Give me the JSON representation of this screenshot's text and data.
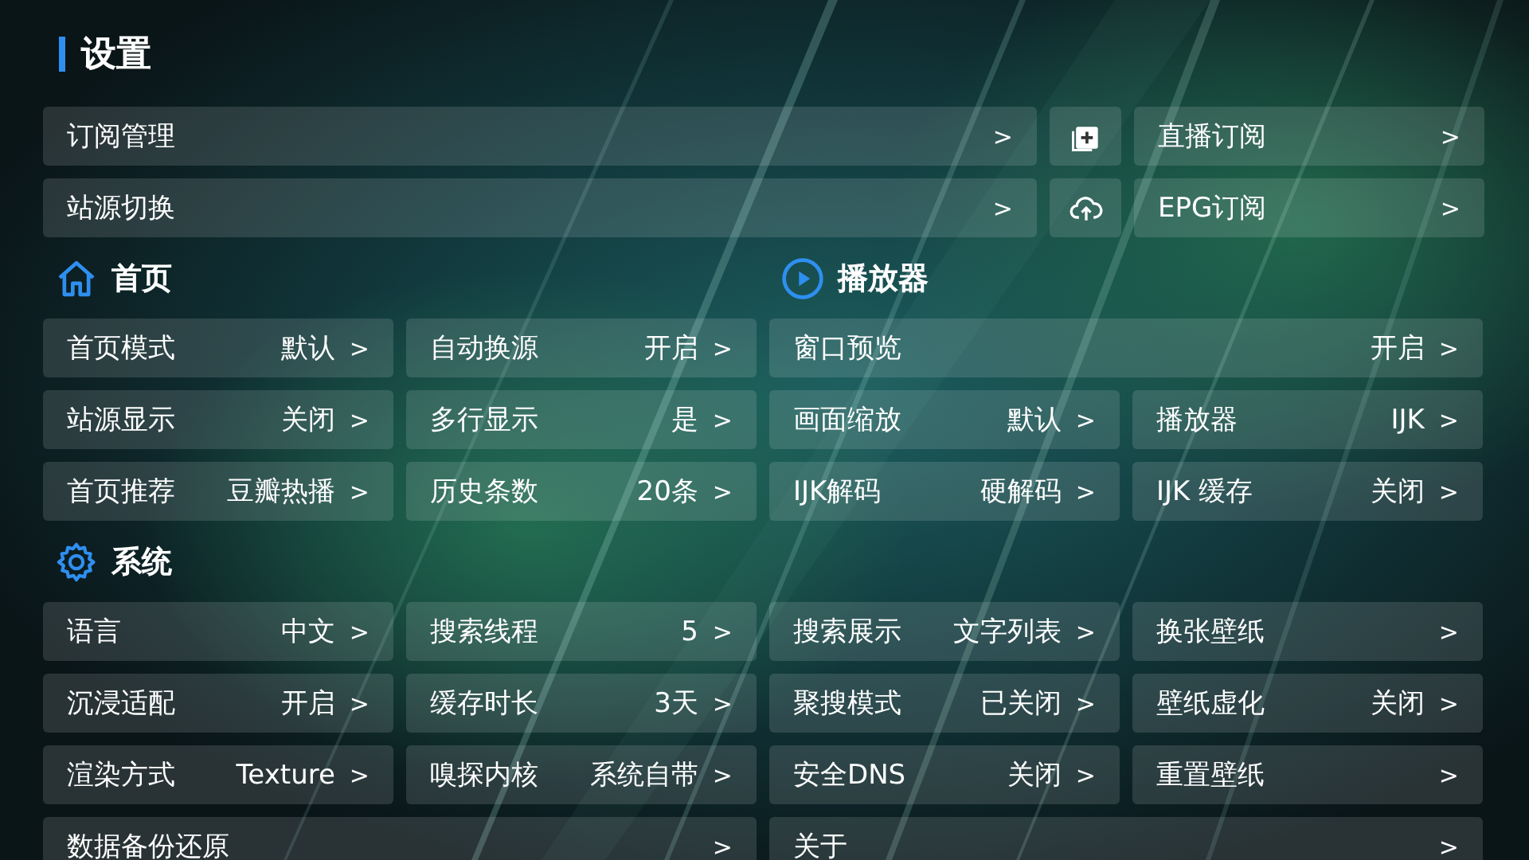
{
  "title": "设置",
  "rows": [
    [
      {
        "kind": "wide",
        "label": "订阅管理",
        "arrow": ">"
      },
      {
        "kind": "add"
      },
      {
        "kind": "setting",
        "label": "直播订阅",
        "arrow": ">"
      }
    ],
    [
      {
        "kind": "wide",
        "label": "站源切换",
        "arrow": ">"
      },
      {
        "kind": "upload"
      },
      {
        "kind": "setting",
        "label": "EPG订阅",
        "arrow": ">"
      }
    ],
    [
      {
        "kind": "heading",
        "label": "首页"
      },
      {
        "kind": "heading",
        "label": "播放器"
      }
    ],
    [
      {
        "kind": "setting",
        "label": "首页模式",
        "value": "默认",
        "arrow": ">"
      },
      {
        "kind": "setting",
        "label": "自动换源",
        "value": "开启",
        "arrow": ">"
      },
      {
        "kind": "double",
        "label": "窗口预览",
        "value": "开启",
        "arrow": ">"
      }
    ],
    [
      {
        "kind": "setting",
        "label": "站源显示",
        "value": "关闭",
        "arrow": ">"
      },
      {
        "kind": "setting",
        "label": "多行显示",
        "value": "是",
        "arrow": ">"
      },
      {
        "kind": "setting",
        "label": "画面缩放",
        "value": "默认",
        "arrow": ">"
      },
      {
        "kind": "setting",
        "label": "播放器",
        "value": "IJK",
        "arrow": ">"
      }
    ],
    [
      {
        "kind": "setting",
        "label": "首页推荐",
        "value": "豆瓣热播",
        "arrow": ">"
      },
      {
        "kind": "setting",
        "label": "历史条数",
        "value": "20条",
        "arrow": ">"
      },
      {
        "kind": "setting",
        "label": "IJK解码",
        "value": "硬解码",
        "arrow": ">"
      },
      {
        "kind": "setting",
        "label": "IJK 缓存",
        "value": "关闭",
        "arrow": ">"
      }
    ],
    [
      {
        "kind": "heading",
        "label": "系统"
      }
    ],
    [
      {
        "kind": "setting",
        "label": "语言",
        "value": "中文",
        "arrow": ">"
      },
      {
        "kind": "setting",
        "label": "搜索线程",
        "value": "5",
        "arrow": ">"
      },
      {
        "kind": "setting",
        "label": "搜索展示",
        "value": "文字列表",
        "arrow": ">"
      },
      {
        "kind": "setting",
        "label": "换张壁纸",
        "arrow": ">"
      }
    ],
    [
      {
        "kind": "setting",
        "label": "沉浸适配",
        "value": "开启",
        "arrow": ">"
      },
      {
        "kind": "setting",
        "label": "缓存时长",
        "value": "3天",
        "arrow": ">"
      },
      {
        "kind": "setting",
        "label": "聚搜模式",
        "value": "已关闭",
        "arrow": ">"
      },
      {
        "kind": "setting",
        "label": "壁纸虚化",
        "value": "关闭",
        "arrow": ">"
      }
    ],
    [
      {
        "kind": "setting",
        "label": "渲染方式",
        "value": "Texture",
        "arrow": ">"
      },
      {
        "kind": "setting",
        "label": "嗅探内核",
        "value": "系统自带",
        "arrow": ">"
      },
      {
        "kind": "setting",
        "label": "安全DNS",
        "value": "关闭",
        "arrow": ">"
      },
      {
        "kind": "setting",
        "label": "重置壁纸",
        "arrow": ">"
      }
    ],
    [
      {
        "kind": "double",
        "label": "数据备份还原",
        "arrow": ">"
      },
      {
        "kind": "double",
        "label": "关于",
        "arrow": ">"
      }
    ]
  ]
}
